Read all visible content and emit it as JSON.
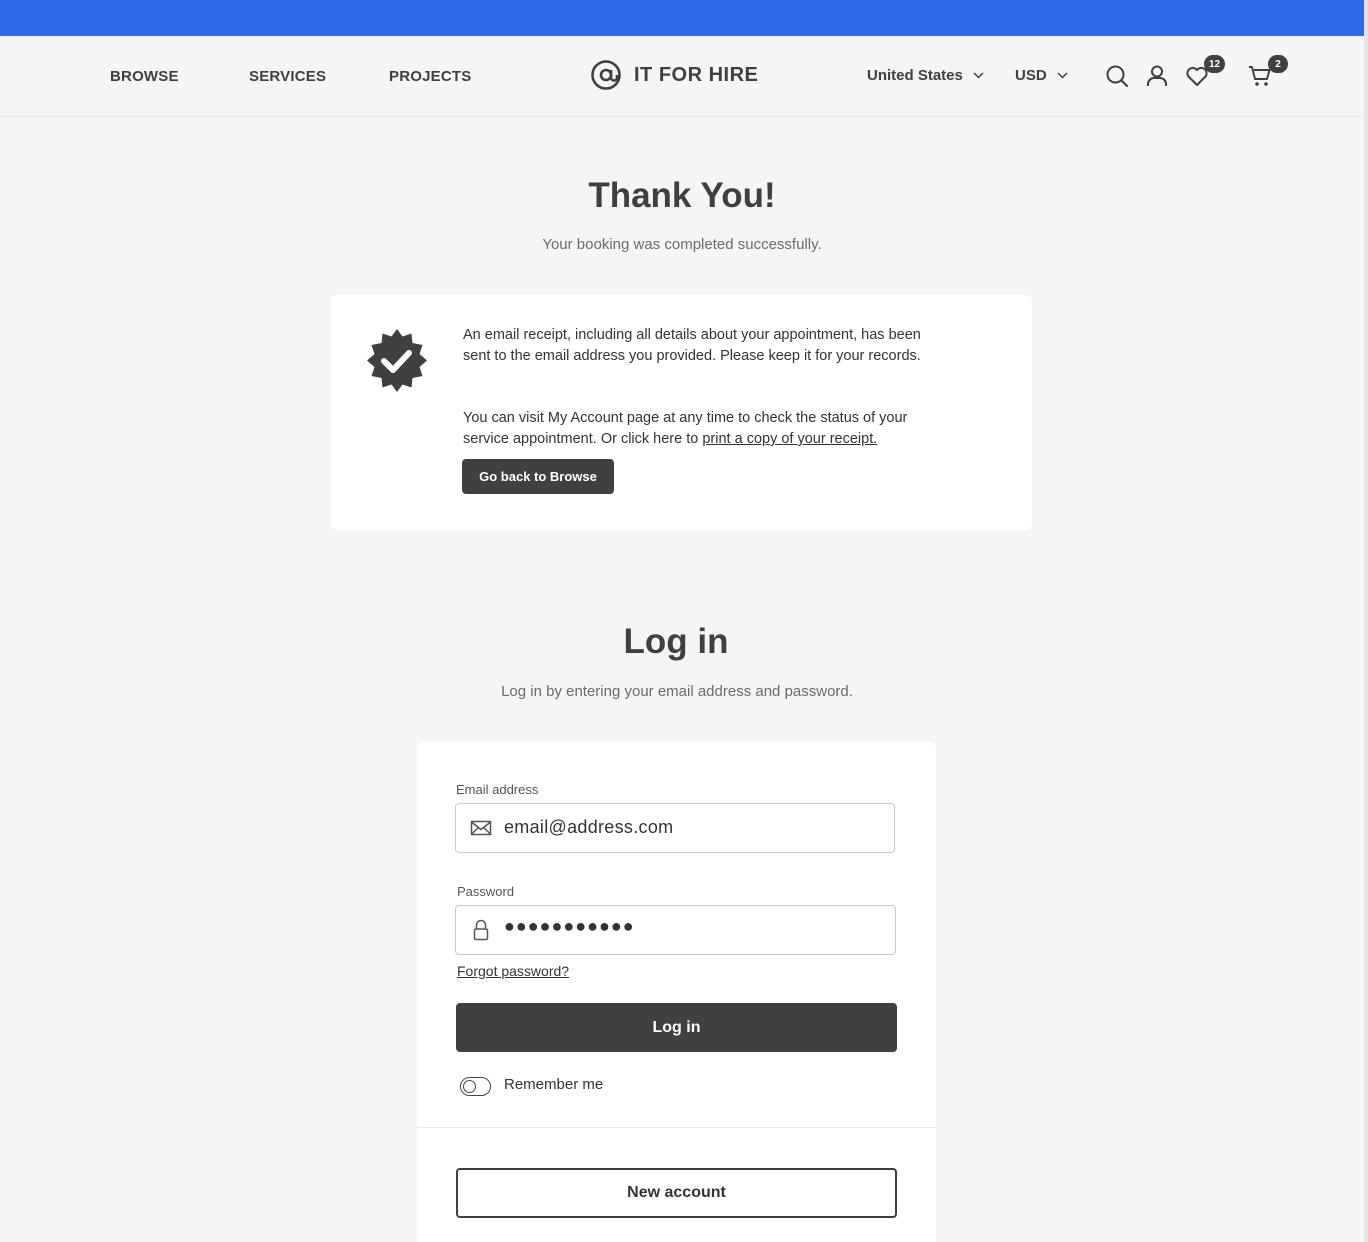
{
  "nav": {
    "browse": "BROWSE",
    "services": "SERVICES",
    "projects": "PROJECTS"
  },
  "brand": {
    "name": "IT FOR HIRE"
  },
  "header": {
    "country": "United States",
    "currency": "USD",
    "wishlist_count": "12",
    "cart_count": "2"
  },
  "confirmation": {
    "title": "Thank You!",
    "subtitle": "Your booking was completed successfully.",
    "paragraph1": "An email receipt, including all details about your appointment, has been sent to the email address you provided. Please keep it for your records.",
    "paragraph2_prefix": "You can visit My Account page at any time to check the status of your service appointment. Or click here to ",
    "receipt_link": "print a copy of your receipt.",
    "back_button": "Go back to Browse"
  },
  "login": {
    "title": "Log in",
    "subtitle": "Log in by entering your email address and password.",
    "email_label": "Email address",
    "email_value": "email@address.com",
    "password_label": "Password",
    "password_value": "●●●●●●●●●●●",
    "forgot_link": "Forgot password?",
    "submit_button": "Log in",
    "remember_label": "Remember me",
    "new_account_button": "New account"
  },
  "colors": {
    "topbar": "#2d68e6",
    "dark": "#404040",
    "background": "#f5f5f5"
  }
}
